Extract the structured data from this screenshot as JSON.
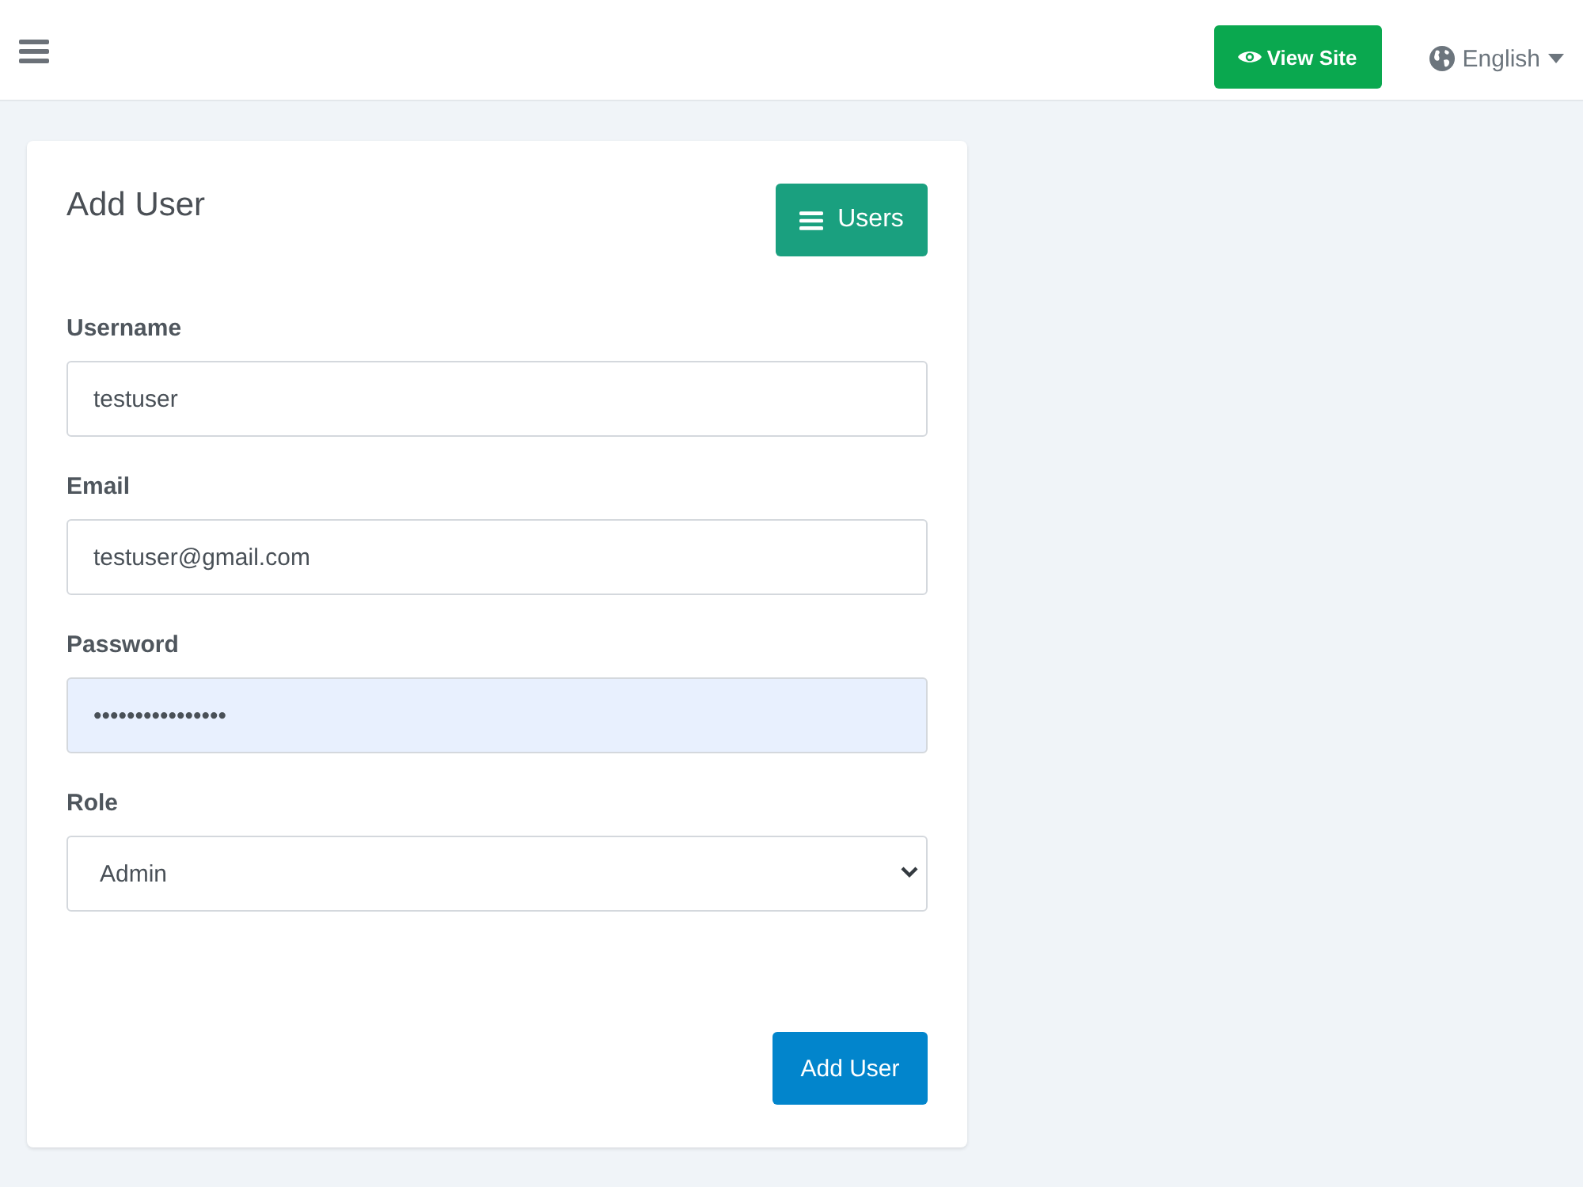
{
  "topbar": {
    "view_site_button": {
      "label": "View Site"
    },
    "language": {
      "label": "English"
    }
  },
  "card": {
    "title": "Add User",
    "users_button": {
      "label": "Users"
    },
    "fields": [
      {
        "kind": "text",
        "label": "Username",
        "value": "testuser",
        "autofilled": false
      },
      {
        "kind": "text",
        "label": "Email",
        "value": "testuser@gmail.com",
        "autofilled": false
      },
      {
        "kind": "password",
        "label": "Password",
        "value": "••••••••••••••••",
        "autofilled": true
      },
      {
        "kind": "select",
        "label": "Role",
        "value": "Admin",
        "autofilled": false
      }
    ],
    "submit_button": {
      "label": "Add User"
    }
  }
}
